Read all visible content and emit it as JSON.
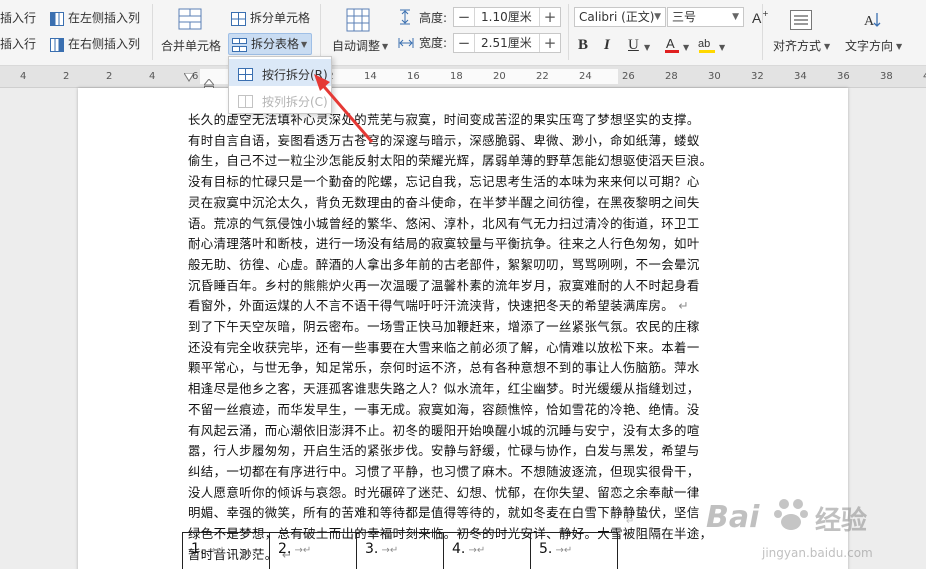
{
  "ribbon": {
    "insert_row_above": "插入行",
    "insert_col_left": "在左侧插入列",
    "insert_row_below": "插入行",
    "insert_col_right": "在右侧插入列",
    "merge_cells": "合并单元格",
    "split_cells": "拆分单元格",
    "split_table": "拆分表格",
    "auto_fit": "自动调整",
    "height_label": "高度:",
    "height_value": "1.10厘米",
    "width_label": "宽度:",
    "width_value": "2.51厘米",
    "font_name": "Calibri (正文)",
    "font_size": "三号",
    "align_label": "对齐方式",
    "text_direction_label": "文字方向"
  },
  "menu": {
    "items": [
      {
        "label": "按行拆分(R)",
        "enabled": true
      },
      {
        "label": "按列拆分(C)",
        "enabled": false
      }
    ]
  },
  "ruler": {
    "ticks": [
      "4",
      "2",
      "2",
      "4",
      "6",
      "8",
      "10",
      "12",
      "14",
      "16",
      "18",
      "20",
      "22",
      "24",
      "26",
      "28",
      "30",
      "32",
      "34",
      "36",
      "38",
      "40"
    ]
  },
  "document": {
    "lines": [
      "长久的虚空无法填补心灵深处的荒芜与寂寞，时间变成苦涩的果实压弯了梦想坚实的支撑。",
      "有时自言自语，妄图看透万古苍穹的深邃与暗示，深感脆弱、卑微、渺小，命如纸薄，蝼蚁",
      "偷生，自己不过一粒尘沙怎能反射太阳的荣耀光辉，孱弱单薄的野草怎能幻想驱使滔天巨浪。",
      "没有目标的忙碌只是一个勤奋的陀螺，忘记自我，忘记思考生活的本味为来来何以可期？心",
      "灵在寂寞中沉沦太久，背负无数理由的奋斗使命，在半梦半醒之间彷徨，在黑夜黎明之间失",
      "语。荒凉的气氛侵蚀小城曾经的繁华、悠闲、淳朴，北风有气无力扫过清冷的街道，环卫工",
      "耐心清理落叶和断枝，进行一场没有结局的寂寞较量与平衡抗争。往来之人行色匆匆，如叶",
      "般无助、彷徨、心虚。醉酒的人拿出多年前的古老部件，絮絮叨叨，骂骂咧咧，不一会晕沉",
      "沉昏睡百年。乡村的熊熊炉火再一次温暖了温馨朴素的流年岁月，寂寞难耐的人不时起身看",
      "看窗外，外面运煤的人不言不语干得气喘吁吁汗流浃背，快速把冬天的希望装满库房。",
      "到了下午天空灰暗，阴云密布。一场雪正快马加鞭赶来，增添了一丝紧张气氛。农民的庄稼",
      "还没有完全收获完毕，还有一些事要在大雪来临之前必须了解，心情难以放松下来。本着一",
      "颗平常心，与世无争，知足常乐，奈何时运不济，总有各种意想不到的事让人伤脑筋。萍水",
      "相逢尽是他乡之客，天涯孤客谁悲失路之人？似水流年，红尘幽梦。时光缓缓从指缝划过，",
      "不留一丝痕迹，而华发早生，一事无成。寂寞如海，容颜憔悴，恰如雪花的冷艳、绝情。没",
      "有风起云涌，而心潮依旧澎湃不止。初冬的暖阳开始唤醒小城的沉睡与安宁，没有太多的喧",
      "嚣，行人步履匆匆，开启生活的紧张步伐。安静与舒缓，忙碌与协作，白发与黑发，希望与",
      "纠结，一切都在有序进行中。习惯了平静，也习惯了麻木。不想随波逐流，但现实很骨干，",
      "没人愿意听你的倾诉与哀怨。时光碾碎了迷茫、幻想、忧郁，在你失望、留恋之余奉献一律",
      "明媚、幸强的微笑，所有的苦难和等待都是值得等待的，就如冬麦在白雪下静静蛰伏，坚信",
      "绿色不是梦想，总有破土而出的幸福时刻来临。初冬的时光安详、静好。大雪被阻隔在半途，",
      "暂时音讯渺茫。"
    ],
    "table_cells": [
      "1.",
      "2.",
      "3.",
      "4.",
      "5."
    ]
  },
  "watermark": {
    "brand": "Bai",
    "brand2": "经验",
    "url": "jingyan.baidu.com"
  },
  "colors": {
    "accent_arrow": "#e53935",
    "menu_highlight": "#dbe8f7",
    "font_color_bar": "#e02020",
    "highlight_bar": "#ffd800"
  }
}
